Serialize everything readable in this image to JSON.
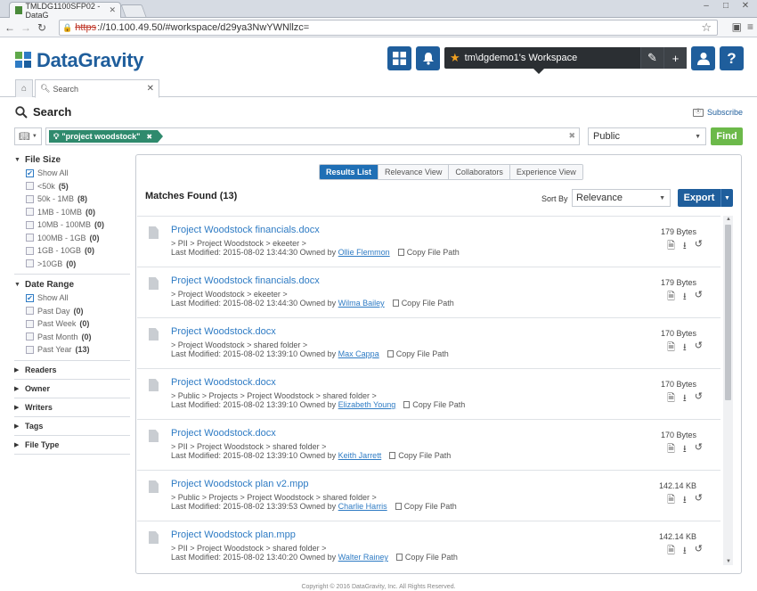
{
  "browser": {
    "tab_title": "TMLDG1100SFP02 - DataG",
    "url_scheme": "https",
    "url_rest": "://10.100.49.50/#workspace/d29ya3NwYWNllzc="
  },
  "header": {
    "logo_text": "DataGravity",
    "workspace_name": "tm\\dgdemo1's Workspace"
  },
  "tabs": {
    "search_tab": "Search"
  },
  "search": {
    "title": "Search",
    "subscribe": "Subscribe",
    "query_tag": "\"project woodstock\"",
    "visibility": "Public",
    "find": "Find"
  },
  "facets": {
    "file_size": {
      "label": "File Size",
      "options": [
        {
          "label": "Show All",
          "count": "",
          "checked": true
        },
        {
          "label": "<50k",
          "count": "(5)",
          "checked": false
        },
        {
          "label": "50k - 1MB",
          "count": "(8)",
          "checked": false
        },
        {
          "label": "1MB - 10MB",
          "count": "(0)",
          "checked": false
        },
        {
          "label": "10MB - 100MB",
          "count": "(0)",
          "checked": false
        },
        {
          "label": "100MB - 1GB",
          "count": "(0)",
          "checked": false
        },
        {
          "label": "1GB - 10GB",
          "count": "(0)",
          "checked": false
        },
        {
          "label": ">10GB",
          "count": "(0)",
          "checked": false
        }
      ]
    },
    "date_range": {
      "label": "Date Range",
      "options": [
        {
          "label": "Show All",
          "count": "",
          "checked": true
        },
        {
          "label": "Past Day",
          "count": "(0)",
          "checked": false
        },
        {
          "label": "Past Week",
          "count": "(0)",
          "checked": false
        },
        {
          "label": "Past Month",
          "count": "(0)",
          "checked": false
        },
        {
          "label": "Past Year",
          "count": "(13)",
          "checked": false
        }
      ]
    },
    "collapsed": [
      "Readers",
      "Owner",
      "Writers",
      "Tags",
      "File Type"
    ]
  },
  "results": {
    "view_tabs": [
      "Results List",
      "Relevance View",
      "Collaborators",
      "Experience View"
    ],
    "matches_label": "Matches Found (13)",
    "sort_label": "Sort By",
    "sort_value": "Relevance",
    "export": "Export",
    "items": [
      {
        "title": "Project Woodstock financials.docx",
        "path": "> PII > Project Woodstock > ekeeter >",
        "modified": "Last Modified: 2015-08-02 13:44:30",
        "owned_by": "Owned by",
        "owner": "Ollie Flemmon",
        "copy": "Copy File Path",
        "size": "179 Bytes"
      },
      {
        "title": "Project Woodstock financials.docx",
        "path": "> Project Woodstock > ekeeter >",
        "modified": "Last Modified: 2015-08-02 13:44:30",
        "owned_by": "Owned by",
        "owner": "Wilma Bailey",
        "copy": "Copy File Path",
        "size": "179 Bytes"
      },
      {
        "title": "Project Woodstock.docx",
        "path": "> Project Woodstock > shared folder >",
        "modified": "Last Modified: 2015-08-02 13:39:10",
        "owned_by": "Owned by",
        "owner": "Max Cappa",
        "copy": "Copy File Path",
        "size": "170 Bytes"
      },
      {
        "title": "Project Woodstock.docx",
        "path": "> Public > Projects > Project Woodstock > shared folder >",
        "modified": "Last Modified: 2015-08-02 13:39:10",
        "owned_by": "Owned by",
        "owner": "Elizabeth Young",
        "copy": "Copy File Path",
        "size": "170 Bytes"
      },
      {
        "title": "Project Woodstock.docx",
        "path": "> PII > Project Woodstock > shared folder >",
        "modified": "Last Modified: 2015-08-02 13:39:10",
        "owned_by": "Owned by",
        "owner": "Keith Jarrett",
        "copy": "Copy File Path",
        "size": "170 Bytes"
      },
      {
        "title": "Project Woodstock plan v2.mpp",
        "path": "> Public > Projects > Project Woodstock > shared folder >",
        "modified": "Last Modified: 2015-08-02 13:39:53",
        "owned_by": "Owned by",
        "owner": "Charlie Harris",
        "copy": "Copy File Path",
        "size": "142.14 KB"
      },
      {
        "title": "Project Woodstock plan.mpp",
        "path": "> PII > Project Woodstock > shared folder >",
        "modified": "Last Modified: 2015-08-02 13:40:20",
        "owned_by": "Owned by",
        "owner": "Walter Rainey",
        "copy": "Copy File Path",
        "size": "142.14 KB"
      }
    ]
  },
  "footer": "Copyright © 2016 DataGravity, Inc. All Rights Reserved."
}
